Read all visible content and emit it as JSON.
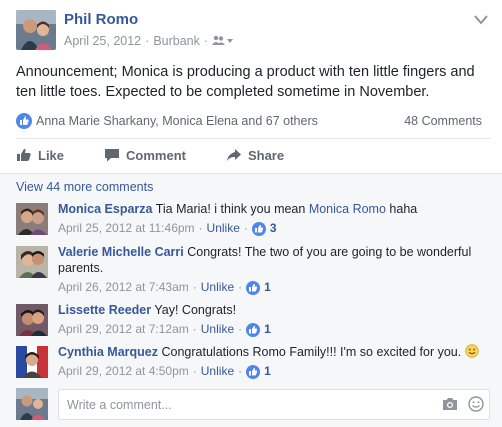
{
  "post": {
    "author": "Phil Romo",
    "date": "April 25, 2012",
    "location": "Burbank",
    "separator": "·",
    "text": "Announcement; Monica is producing a product with ten little fingers and ten little toes. Expected to be completed sometime in November."
  },
  "reactions": {
    "names": "Anna Marie Sharkany, Monica Elena and 67 others",
    "comments_count": "48 Comments"
  },
  "actions": {
    "like": "Like",
    "comment": "Comment",
    "share": "Share"
  },
  "comments_section": {
    "view_more": "View 44 more comments",
    "items": [
      {
        "name": "Monica Esparza",
        "text_before": "Tia Maria! i think you mean ",
        "mention": "Monica Romo",
        "text_after": " haha",
        "date": "April 25, 2012 at 11:46pm",
        "unlike": "Unlike",
        "likes": "3"
      },
      {
        "name": "Valerie Michelle Carri",
        "text": "Congrats! The two of you are going to be wonderful parents.",
        "date": "April 26, 2012 at 7:43am",
        "unlike": "Unlike",
        "likes": "1"
      },
      {
        "name": "Lissette Reeder",
        "text": "Yay! Congrats!",
        "date": "April 29, 2012 at 7:12am",
        "unlike": "Unlike",
        "likes": "1"
      },
      {
        "name": "Cynthia Marquez",
        "text": "Congratulations Romo Family!!! I'm so excited for you.",
        "date": "April 29, 2012 at 4:50pm",
        "unlike": "Unlike",
        "likes": "1"
      }
    ],
    "dot": "·"
  },
  "compose": {
    "placeholder": "Write a comment..."
  },
  "icons": {
    "audience": "friends-icon",
    "menu": "chevron-down-icon",
    "like": "thumbs-up-icon",
    "comment": "speech-bubble-icon",
    "share": "share-arrow-icon",
    "camera": "camera-icon",
    "emoji": "smiley-icon"
  },
  "colors": {
    "link": "#365899",
    "meta": "#90949c",
    "like_blue": "#4f86ec",
    "comments_bg": "#f6f7f9"
  }
}
